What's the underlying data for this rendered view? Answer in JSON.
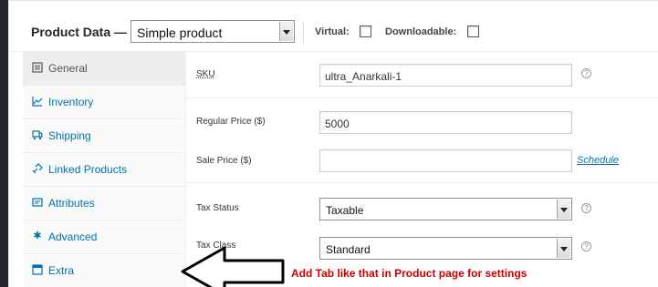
{
  "header": {
    "title": "Product Data —",
    "product_type": "Simple product",
    "virtual_label": "Virtual:",
    "downloadable_label": "Downloadable:"
  },
  "tabs": [
    {
      "label": "General",
      "icon": "general-icon"
    },
    {
      "label": "Inventory",
      "icon": "inventory-icon"
    },
    {
      "label": "Shipping",
      "icon": "shipping-icon"
    },
    {
      "label": "Linked Products",
      "icon": "link-icon"
    },
    {
      "label": "Attributes",
      "icon": "attributes-icon"
    },
    {
      "label": "Advanced",
      "icon": "gear-icon"
    },
    {
      "label": "Extra",
      "icon": "window-icon"
    }
  ],
  "fields": {
    "sku_label": "SKU",
    "sku_value": "ultra_Anarkali-1",
    "regular_price_label": "Regular Price ($)",
    "regular_price_value": "5000",
    "sale_price_label": "Sale Price ($)",
    "sale_price_value": "",
    "schedule_link": "Schedule",
    "tax_status_label": "Tax Status",
    "tax_status_value": "Taxable",
    "tax_class_label": "Tax Class",
    "tax_class_value": "Standard",
    "help_glyph": "?"
  },
  "annotation": {
    "note": "Add Tab like that in Product page for settings",
    "color": "#cc0000"
  },
  "colors": {
    "link": "#0073aa",
    "sidebar": "#23282d"
  }
}
